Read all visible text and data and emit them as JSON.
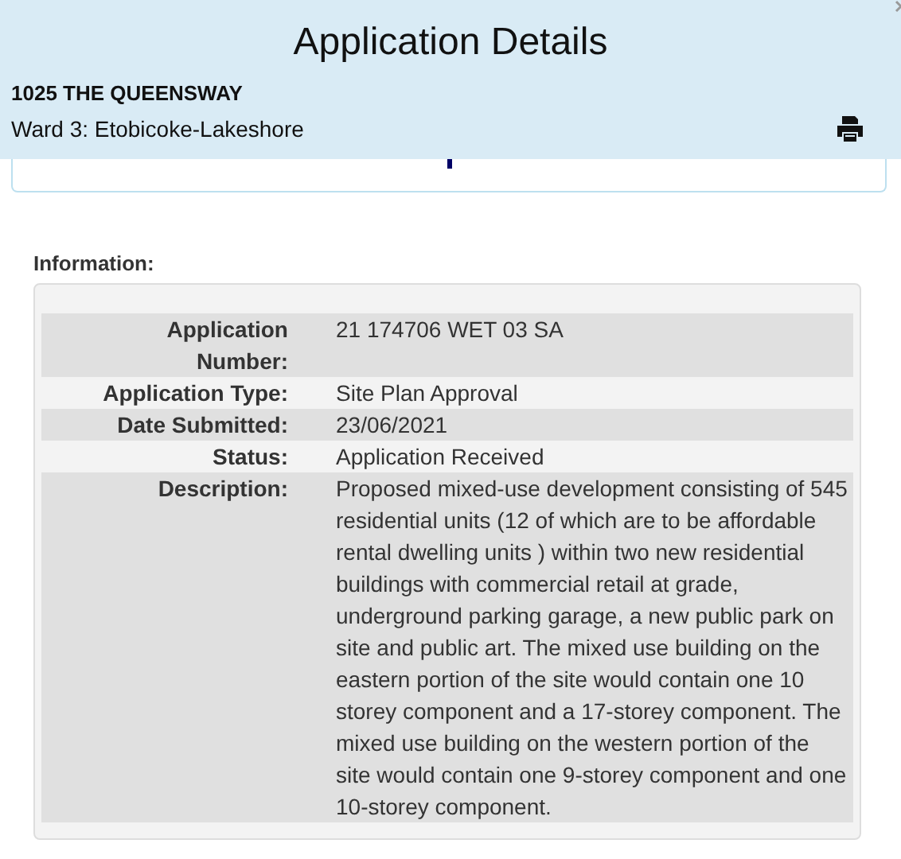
{
  "header": {
    "title": "Application Details",
    "address": "1025 THE QUEENSWAY",
    "ward": "Ward 3: Etobicoke-Lakeshore"
  },
  "information": {
    "heading": "Information:",
    "rows": [
      {
        "label": "Application Number:",
        "value": "21 174706 WET 03 SA"
      },
      {
        "label": "Application Type:",
        "value": "Site Plan Approval"
      },
      {
        "label": "Date Submitted:",
        "value": "23/06/2021"
      },
      {
        "label": "Status:",
        "value": "Application Received"
      },
      {
        "label": "Description:",
        "value": "Proposed mixed-use development consisting of 545 residential units (12 of which are to be affordable rental dwelling units ) within two new residential buildings with commercial retail at grade, underground parking garage, a new public park on site and public art. The mixed use building on the eastern portion of the site would contain one 10 storey component and a 17-storey component. The mixed use building on the western portion of the site would contain one 9-storey component and one 10-storey component."
      }
    ]
  }
}
